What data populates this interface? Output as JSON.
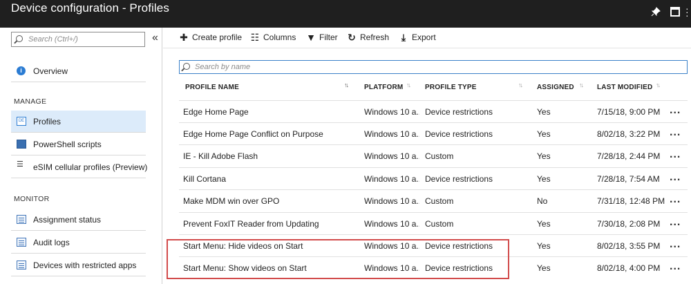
{
  "window": {
    "title": "Device configuration - Profiles"
  },
  "sidebar": {
    "search_placeholder": "Search (Ctrl+/)",
    "items": [
      {
        "label": "Overview",
        "icon": "info-icon"
      },
      {
        "label": "Profiles",
        "icon": "profiles-icon",
        "active": true
      },
      {
        "label": "PowerShell scripts",
        "icon": "powershell-icon"
      },
      {
        "label": "eSIM cellular profiles (Preview)",
        "icon": "checklist-icon"
      },
      {
        "label": "Assignment status",
        "icon": "document-icon"
      },
      {
        "label": "Audit logs",
        "icon": "document-icon"
      },
      {
        "label": "Devices with restricted apps",
        "icon": "document-icon"
      }
    ],
    "sections": {
      "manage": "MANAGE",
      "monitor": "MONITOR"
    }
  },
  "toolbar": {
    "create_profile": "Create profile",
    "columns": "Columns",
    "filter": "Filter",
    "refresh": "Refresh",
    "export": "Export"
  },
  "table": {
    "search_placeholder": "Search by name",
    "columns": [
      "PROFILE NAME",
      "PLATFORM",
      "PROFILE TYPE",
      "ASSIGNED",
      "LAST MODIFIED"
    ],
    "rows": [
      {
        "name": "Edge Home Page",
        "platform": "Windows 10 a...",
        "type": "Device restrictions",
        "assigned": "Yes",
        "modified": "7/15/18, 9:00 PM"
      },
      {
        "name": "Edge Home Page Conflict on Purpose",
        "platform": "Windows 10 a...",
        "type": "Device restrictions",
        "assigned": "Yes",
        "modified": "8/02/18, 3:22 PM"
      },
      {
        "name": "IE - Kill Adobe Flash",
        "platform": "Windows 10 a...",
        "type": "Custom",
        "assigned": "Yes",
        "modified": "7/28/18, 2:44 PM"
      },
      {
        "name": "Kill Cortana",
        "platform": "Windows 10 a...",
        "type": "Device restrictions",
        "assigned": "Yes",
        "modified": "7/28/18, 7:54 AM"
      },
      {
        "name": "Make MDM win over GPO",
        "platform": "Windows 10 a...",
        "type": "Custom",
        "assigned": "No",
        "modified": "7/31/18, 12:48 PM"
      },
      {
        "name": "Prevent FoxIT Reader from Updating",
        "platform": "Windows 10 a...",
        "type": "Custom",
        "assigned": "Yes",
        "modified": "7/30/18, 2:08 PM"
      },
      {
        "name": "Start Menu: Hide videos on Start",
        "platform": "Windows 10 a...",
        "type": "Device restrictions",
        "assigned": "Yes",
        "modified": "8/02/18, 3:55 PM"
      },
      {
        "name": "Start Menu: Show videos on Start",
        "platform": "Windows 10 a...",
        "type": "Device restrictions",
        "assigned": "Yes",
        "modified": "8/02/18, 4:00 PM"
      }
    ],
    "more_label": "..."
  },
  "colors": {
    "titlebar": "#1f1f1f",
    "accent": "#2b7cd3",
    "active_bg": "#dcebfa",
    "highlight": "#d24b4b"
  }
}
